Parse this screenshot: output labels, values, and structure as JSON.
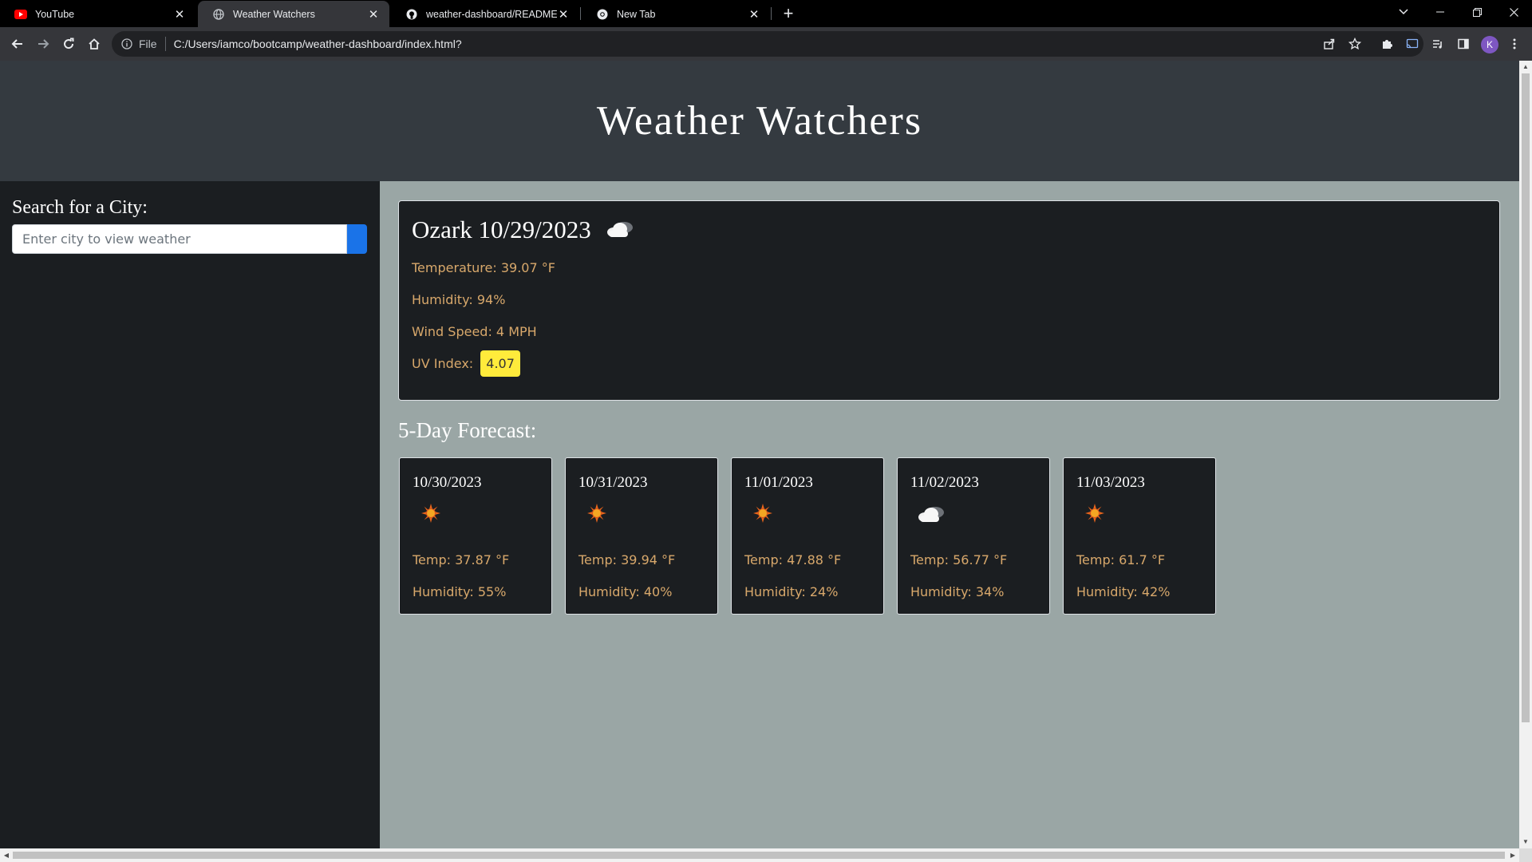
{
  "browser": {
    "tabs": [
      {
        "title": "YouTube",
        "icon": "youtube-icon",
        "active": false
      },
      {
        "title": "Weather Watchers",
        "icon": "globe-icon",
        "active": true
      },
      {
        "title": "weather-dashboard/README.md",
        "icon": "github-icon",
        "active": false
      },
      {
        "title": "New Tab",
        "icon": "chrome-icon",
        "active": false
      }
    ],
    "new_tab": "+",
    "address": {
      "scheme_label": "File",
      "url": "C:/Users/iamco/bootcamp/weather-dashboard/index.html?"
    },
    "profile_initial": "K"
  },
  "page": {
    "title": "Weather Watchers",
    "search": {
      "label": "Search for a City:",
      "placeholder": "Enter city to view weather"
    },
    "current": {
      "heading": "Ozark 10/29/2023",
      "icon": "cloudy-icon",
      "temperature": "Temperature: 39.07 °F",
      "humidity": "Humidity: 94%",
      "wind": "Wind Speed: 4 MPH",
      "uv_label": "UV Index:",
      "uv_value": "4.07"
    },
    "forecast_title": "5-Day Forecast:",
    "forecast": [
      {
        "date": "10/30/2023",
        "icon": "sun-icon",
        "temp": "Temp: 37.87 °F",
        "humidity": "Humidity: 55%"
      },
      {
        "date": "10/31/2023",
        "icon": "sun-icon",
        "temp": "Temp: 39.94 °F",
        "humidity": "Humidity: 40%"
      },
      {
        "date": "11/01/2023",
        "icon": "sun-icon",
        "temp": "Temp: 47.88 °F",
        "humidity": "Humidity: 24%"
      },
      {
        "date": "11/02/2023",
        "icon": "cloudy-icon",
        "temp": "Temp: 56.77 °F",
        "humidity": "Humidity: 34%"
      },
      {
        "date": "11/03/2023",
        "icon": "sun-icon",
        "temp": "Temp: 61.7 °F",
        "humidity": "Humidity: 42%"
      }
    ]
  },
  "colors": {
    "header_bg": "#343a40",
    "sidebar_bg": "#1b1e21",
    "main_bg": "#9aa6a5",
    "stat_text": "#d8a86b",
    "uv_badge": "#ffeb3b",
    "search_button": "#1a73e8"
  }
}
